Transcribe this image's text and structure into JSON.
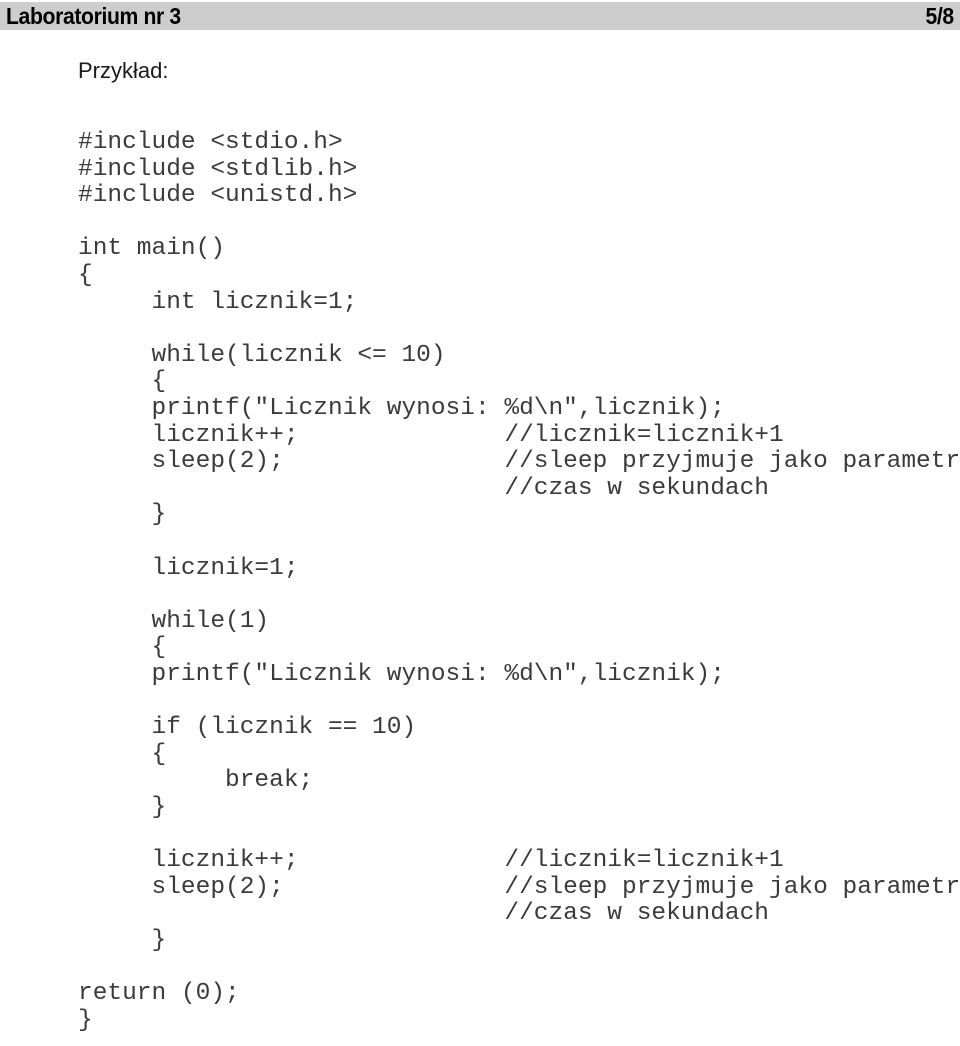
{
  "header": {
    "title": "Laboratorium nr 3",
    "page_indicator": "5/8",
    "background_color": "#cdcdcd",
    "text_color": "#000000"
  },
  "content": {
    "heading": "Przykład:",
    "code_language": "c",
    "code_text_color": "#3b3b3b",
    "code_lines": [
      "#include <stdio.h>",
      "#include <stdlib.h>",
      "#include <unistd.h>",
      "",
      "int main()",
      "{",
      "     int licznik=1;",
      "",
      "     while(licznik <= 10)",
      "     {",
      "     printf(\"Licznik wynosi: %d\\n\",licznik);",
      "     licznik++;              //licznik=licznik+1",
      "     sleep(2);               //sleep przyjmuje jako parametr",
      "                             //czas w sekundach",
      "     }",
      "",
      "     licznik=1;",
      "",
      "     while(1)",
      "     {",
      "     printf(\"Licznik wynosi: %d\\n\",licznik);",
      "",
      "     if (licznik == 10)",
      "     {",
      "          break;",
      "     }",
      "",
      "     licznik++;              //licznik=licznik+1",
      "     sleep(2);               //sleep przyjmuje jako parametr",
      "                             //czas w sekundach",
      "     }",
      "",
      "return (0);",
      "}"
    ]
  }
}
